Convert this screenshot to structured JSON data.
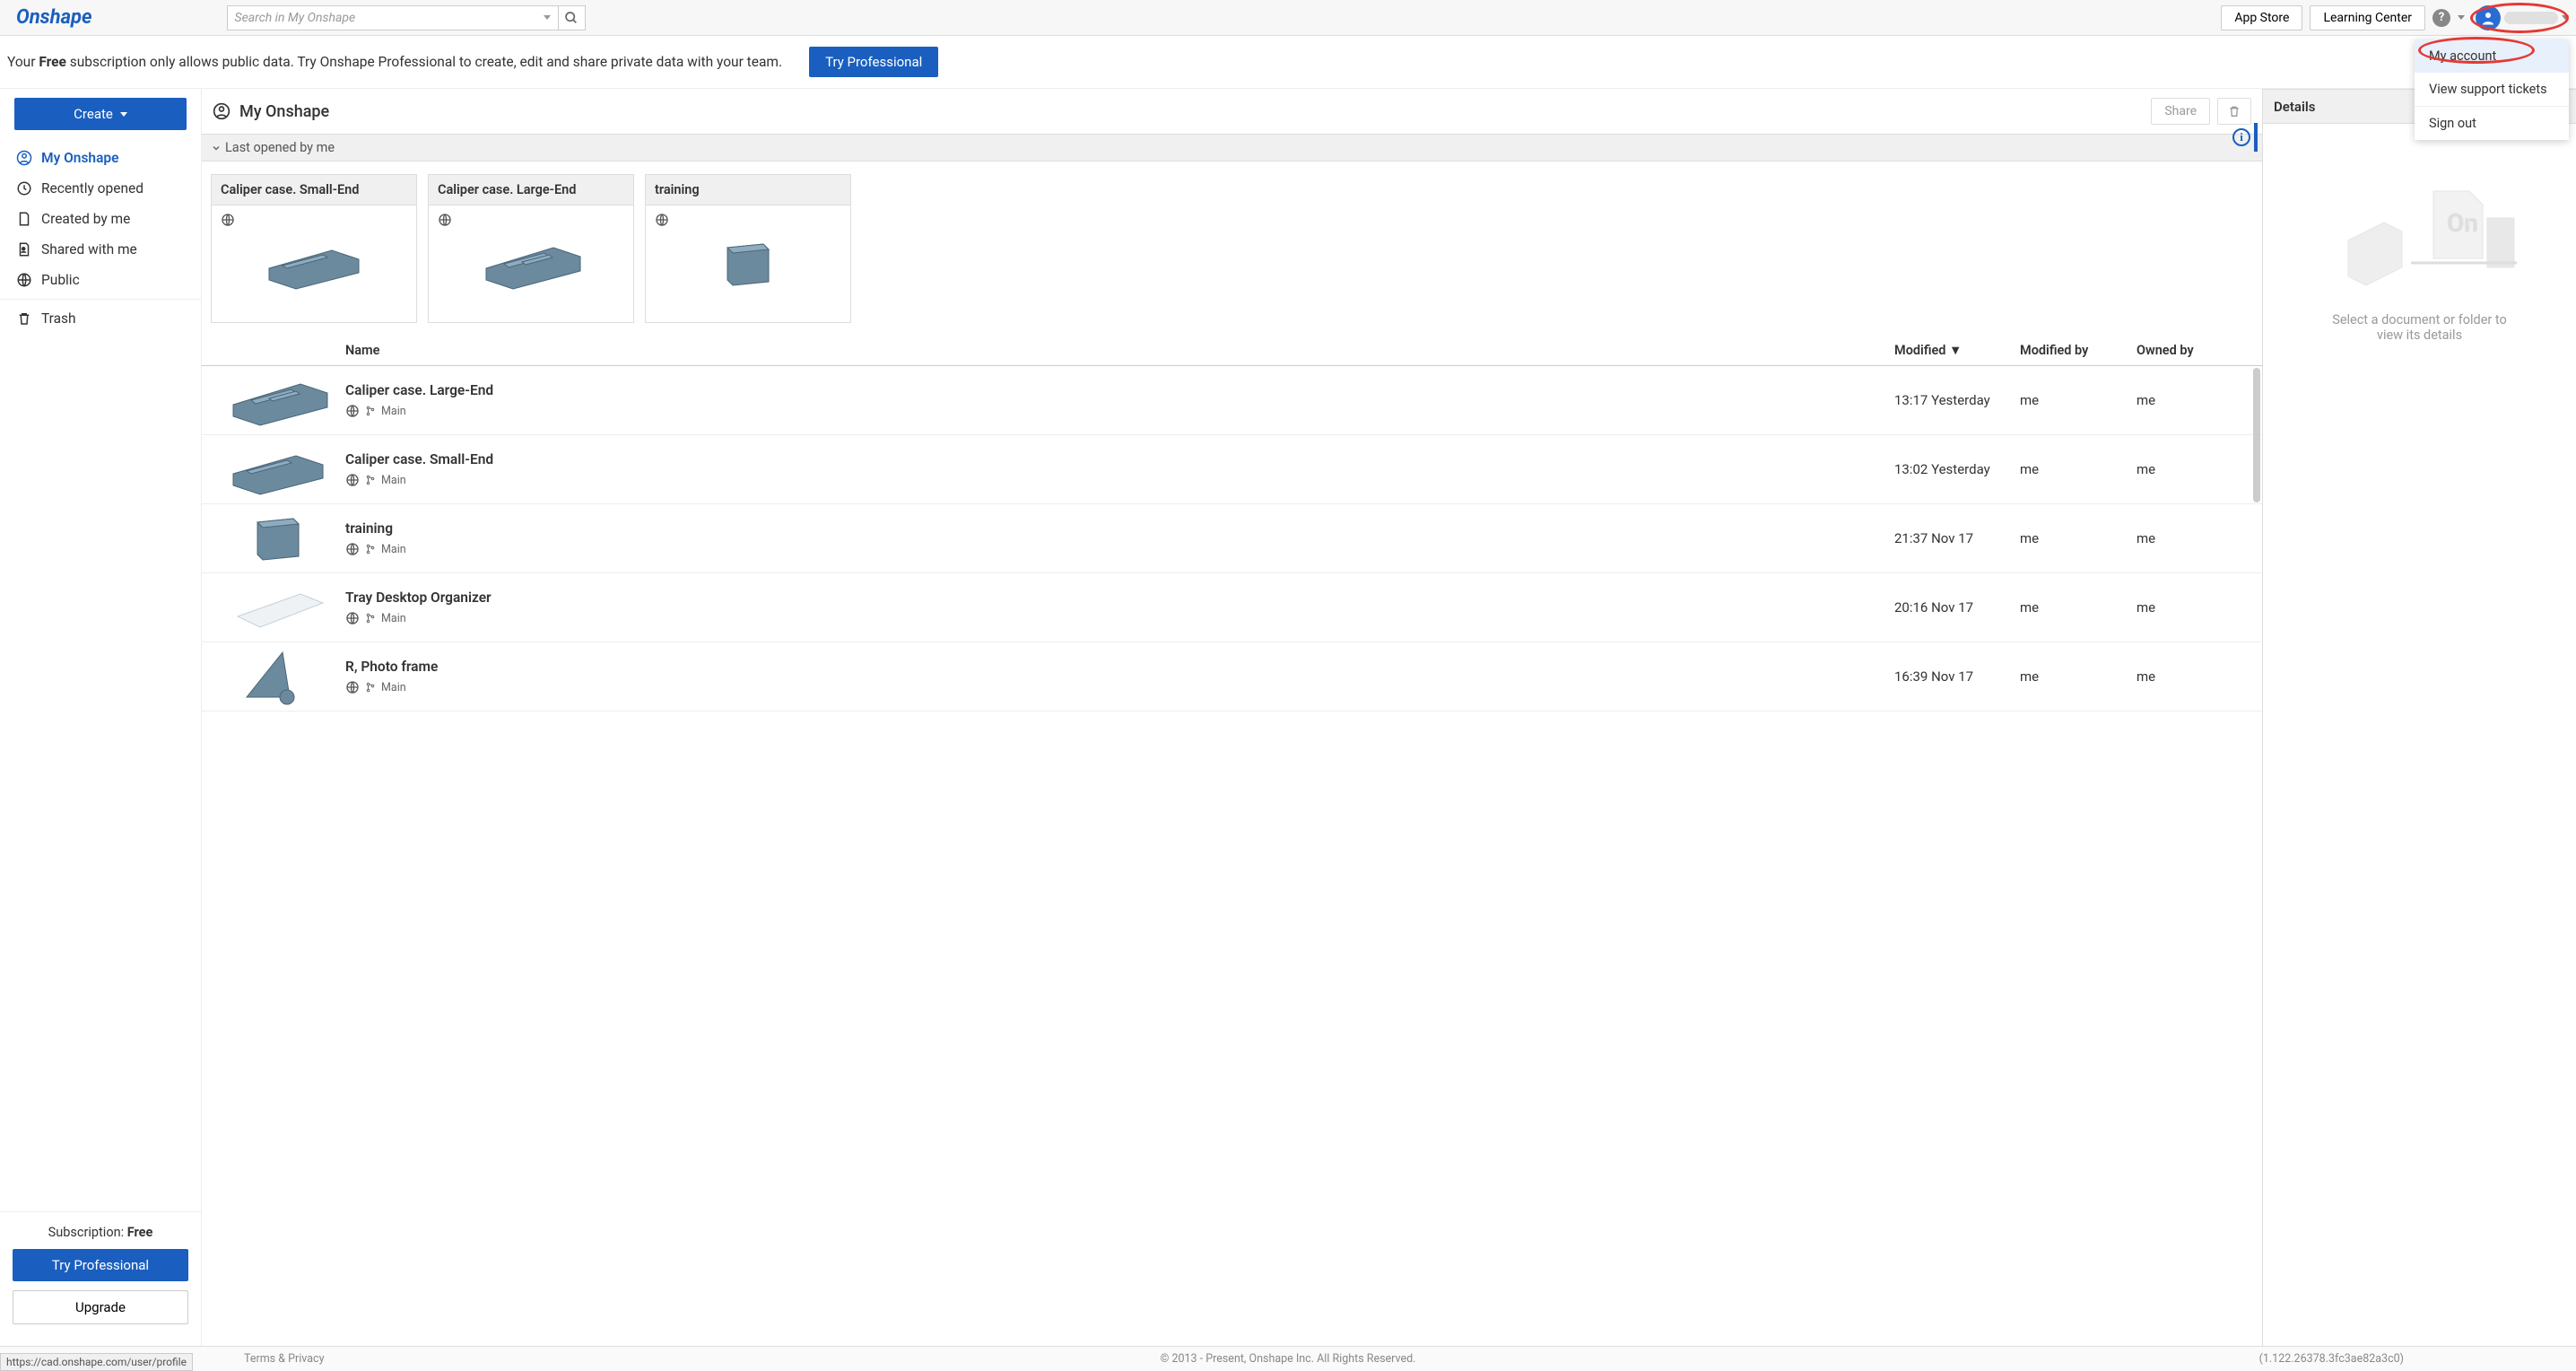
{
  "header": {
    "logo": "Onshape",
    "search_placeholder": "Search in My Onshape",
    "app_store": "App Store",
    "learning_center": "Learning Center"
  },
  "dropdown": {
    "my_account": "My account",
    "support": "View support tickets",
    "sign_out": "Sign out"
  },
  "banner": {
    "text_pre": "Your ",
    "text_bold": "Free",
    "text_post": " subscription only allows public data. Try Onshape Professional to create, edit and share private data with your team.",
    "cta": "Try Professional"
  },
  "sidebar": {
    "create": "Create",
    "nav": {
      "my_onshape": "My Onshape",
      "recently": "Recently opened",
      "created": "Created by me",
      "shared": "Shared with me",
      "public": "Public",
      "trash": "Trash"
    },
    "footer": {
      "sub_pre": "Subscription: ",
      "sub_bold": "Free",
      "try_pro": "Try Professional",
      "upgrade": "Upgrade"
    }
  },
  "content": {
    "title": "My Onshape",
    "share": "Share",
    "sort_label": "Last opened by me",
    "cards": [
      {
        "title": "Caliper case. Small-End"
      },
      {
        "title": "Caliper case. Large-End"
      },
      {
        "title": "training"
      }
    ],
    "columns": {
      "name": "Name",
      "modified": "Modified  ▼",
      "modified_by": "Modified by",
      "owned_by": "Owned by"
    },
    "rows": [
      {
        "name": "Caliper case. Large-End",
        "branch": "Main",
        "modified": "13:17 Yesterday",
        "modified_by": "me",
        "owned_by": "me"
      },
      {
        "name": "Caliper case. Small-End",
        "branch": "Main",
        "modified": "13:02 Yesterday",
        "modified_by": "me",
        "owned_by": "me"
      },
      {
        "name": "training",
        "branch": "Main",
        "modified": "21:37 Nov 17",
        "modified_by": "me",
        "owned_by": "me"
      },
      {
        "name": "Tray Desktop Organizer",
        "branch": "Main",
        "modified": "20:16 Nov 17",
        "modified_by": "me",
        "owned_by": "me"
      },
      {
        "name": "R, Photo frame",
        "branch": "Main",
        "modified": "16:39 Nov 17",
        "modified_by": "me",
        "owned_by": "me"
      }
    ]
  },
  "details": {
    "title": "Details",
    "hint": "Select a document or folder to view its details"
  },
  "footer": {
    "url": "https://cad.onshape.com/user/profile",
    "copyright": "© 2013 - Present, Onshape Inc. All Rights Reserved.",
    "terms": "Terms & Privacy",
    "version": "(1.122.26378.3fc3ae82a3c0)"
  }
}
